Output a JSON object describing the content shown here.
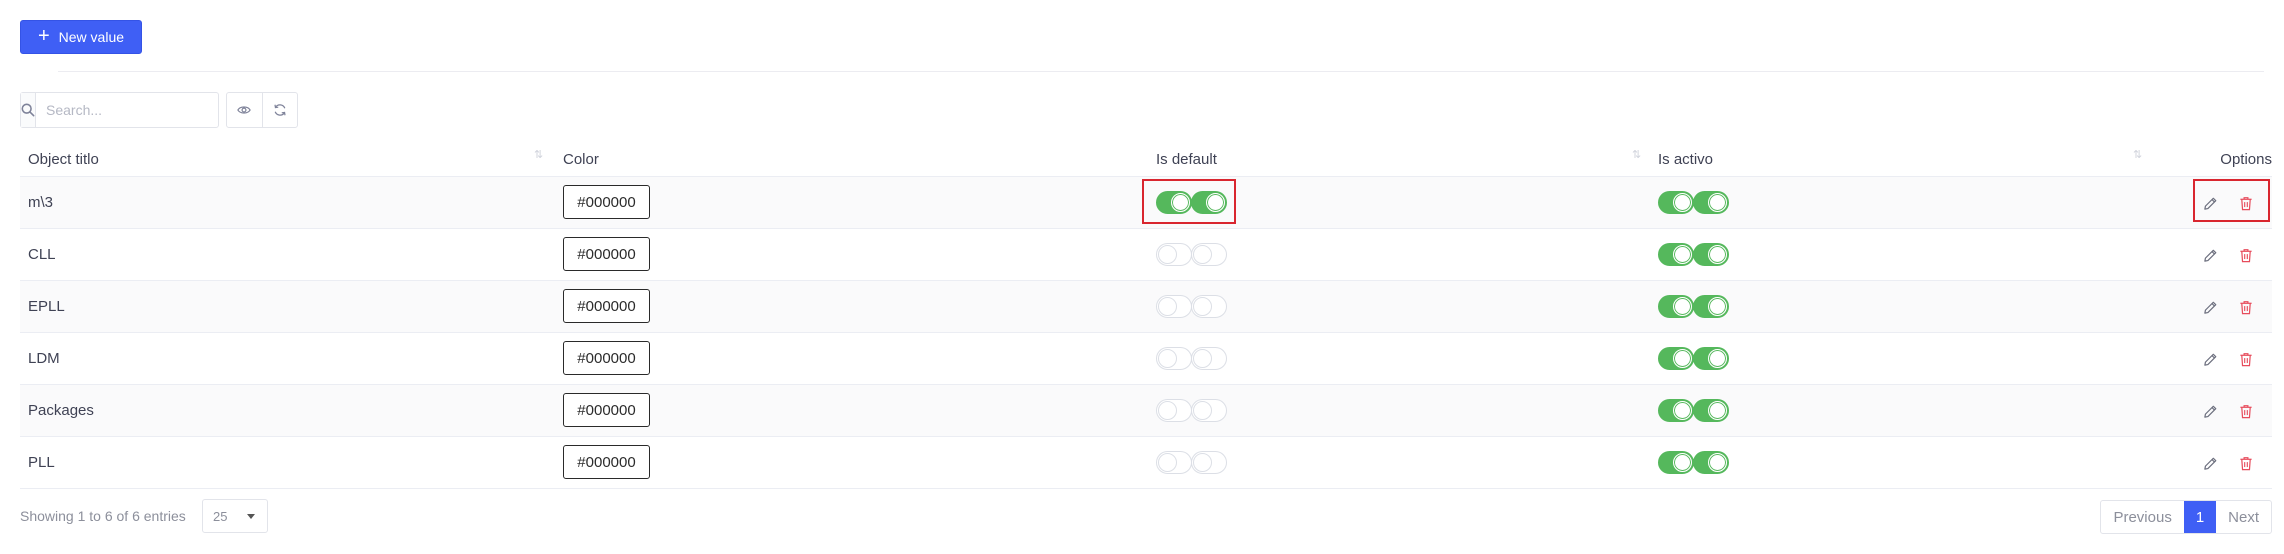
{
  "toolbar": {
    "new_label": "New value"
  },
  "search": {
    "placeholder": "Search..."
  },
  "table": {
    "headers": {
      "title": "Object titlo",
      "color": "Color",
      "is_default": "Is default",
      "is_active": "Is activo",
      "options": "Options"
    },
    "rows": [
      {
        "title": "m\\3",
        "color": "#000000",
        "is_default": true,
        "is_active": true
      },
      {
        "title": "CLL",
        "color": "#000000",
        "is_default": false,
        "is_active": true
      },
      {
        "title": "EPLL",
        "color": "#000000",
        "is_default": false,
        "is_active": true
      },
      {
        "title": "LDM",
        "color": "#000000",
        "is_default": false,
        "is_active": true
      },
      {
        "title": "Packages",
        "color": "#000000",
        "is_default": false,
        "is_active": true
      },
      {
        "title": "PLL",
        "color": "#000000",
        "is_default": false,
        "is_active": true
      }
    ]
  },
  "footer": {
    "info": "Showing 1 to 6 of 6 entries",
    "page_size": "25",
    "previous": "Previous",
    "current_page": "1",
    "next": "Next"
  },
  "colors": {
    "accent": "#3f5ff5",
    "toggle_on": "#55b85c",
    "delete": "#e74c5c",
    "highlight": "#d9262f"
  },
  "icons": {
    "search": "search-icon",
    "view": "eye-icon",
    "refresh": "refresh-icon",
    "edit": "pencil-icon",
    "delete": "trash-icon"
  }
}
